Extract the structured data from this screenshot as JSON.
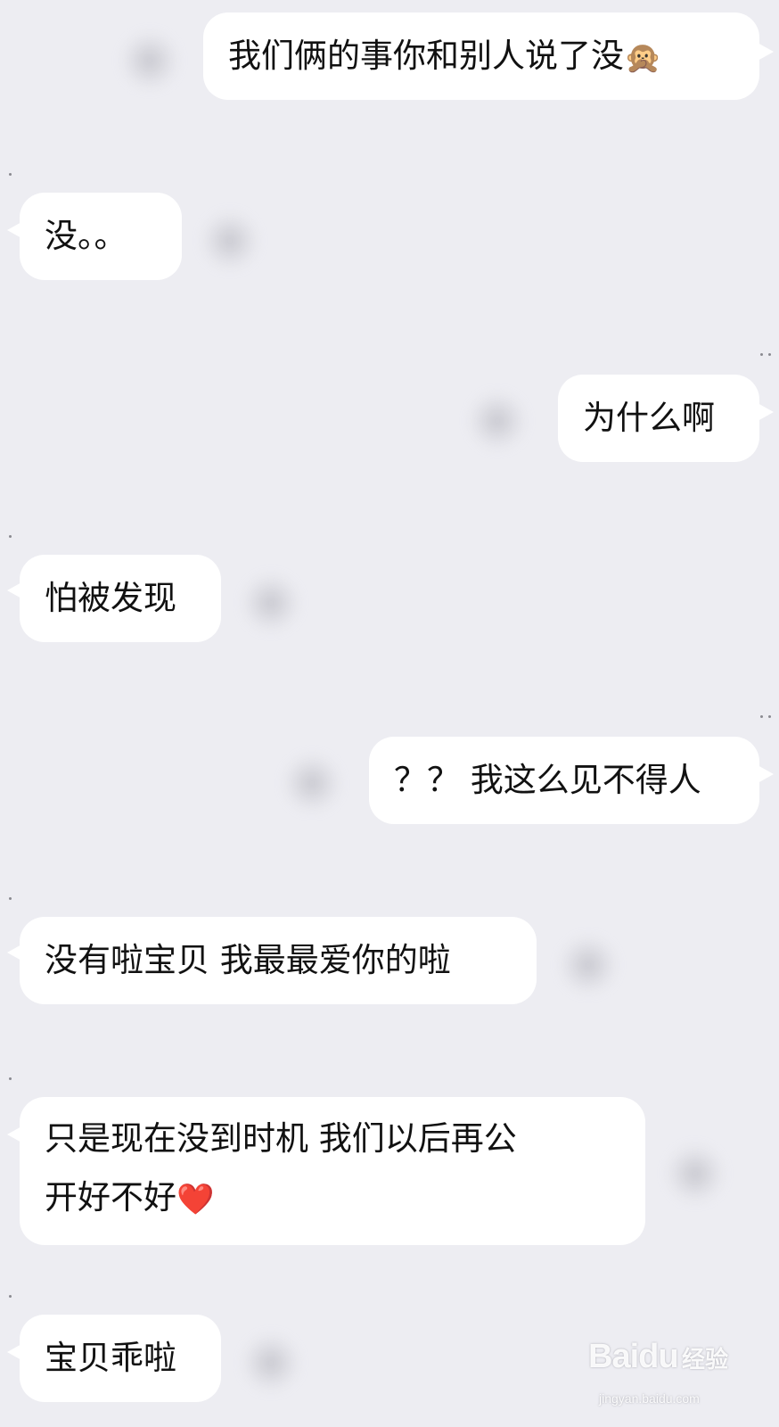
{
  "messages": [
    {
      "side": "right",
      "text": "我们俩的事你和别人说了没",
      "emoji": "🙊"
    },
    {
      "side": "left",
      "text": "没。。"
    },
    {
      "side": "right",
      "text": "为什么啊"
    },
    {
      "side": "left",
      "text": "怕被发现"
    },
    {
      "side": "right",
      "text": "？？ 我这么见不得人"
    },
    {
      "side": "left",
      "text": "没有啦宝贝 我最最爱你的啦"
    },
    {
      "side": "left",
      "text_line1": "只是现在没到时机 我们以后再公",
      "text_line2": "开好不好",
      "emoji": "❤️"
    },
    {
      "side": "left",
      "text": "宝贝乖啦"
    }
  ],
  "watermark": {
    "logo": "Baidu",
    "sub": "经验",
    "url": "jingyan.baidu.com"
  },
  "colors": {
    "background": "#EDEDF2",
    "bubble": "#FFFFFF",
    "text": "#111111"
  }
}
